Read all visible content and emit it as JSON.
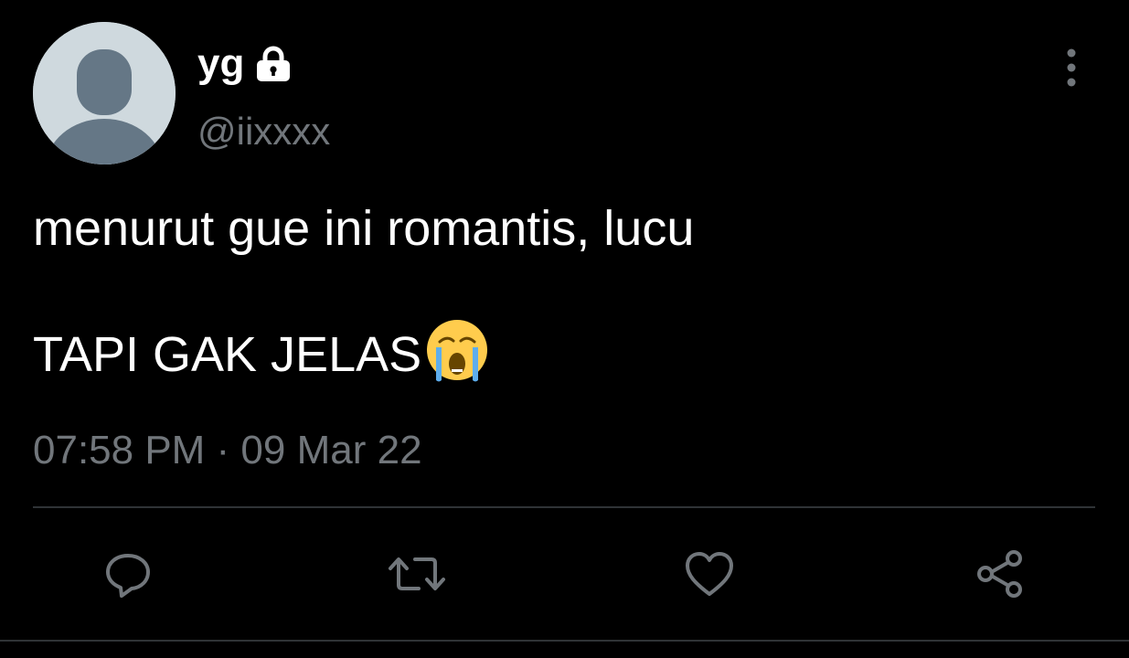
{
  "tweet": {
    "display_name": "yg",
    "handle": "@iixxxx",
    "text_line1": "menurut gue ini romantis, lucu",
    "text_line2": "TAPI GAK JELAS",
    "timestamp": "07:58 PM · 09 Mar 22",
    "icons": {
      "protected": "lock-icon",
      "emoji": "loudly-crying-face-emoji",
      "more": "more-vertical-icon",
      "reply": "reply-icon",
      "retweet": "retweet-icon",
      "like": "heart-icon",
      "share": "share-icon"
    }
  },
  "colors": {
    "background": "#000000",
    "primary_text": "#ffffff",
    "secondary_text": "#71767b",
    "divider": "#2f3336",
    "avatar_bg": "#cfd9de",
    "avatar_fg": "#657786"
  }
}
